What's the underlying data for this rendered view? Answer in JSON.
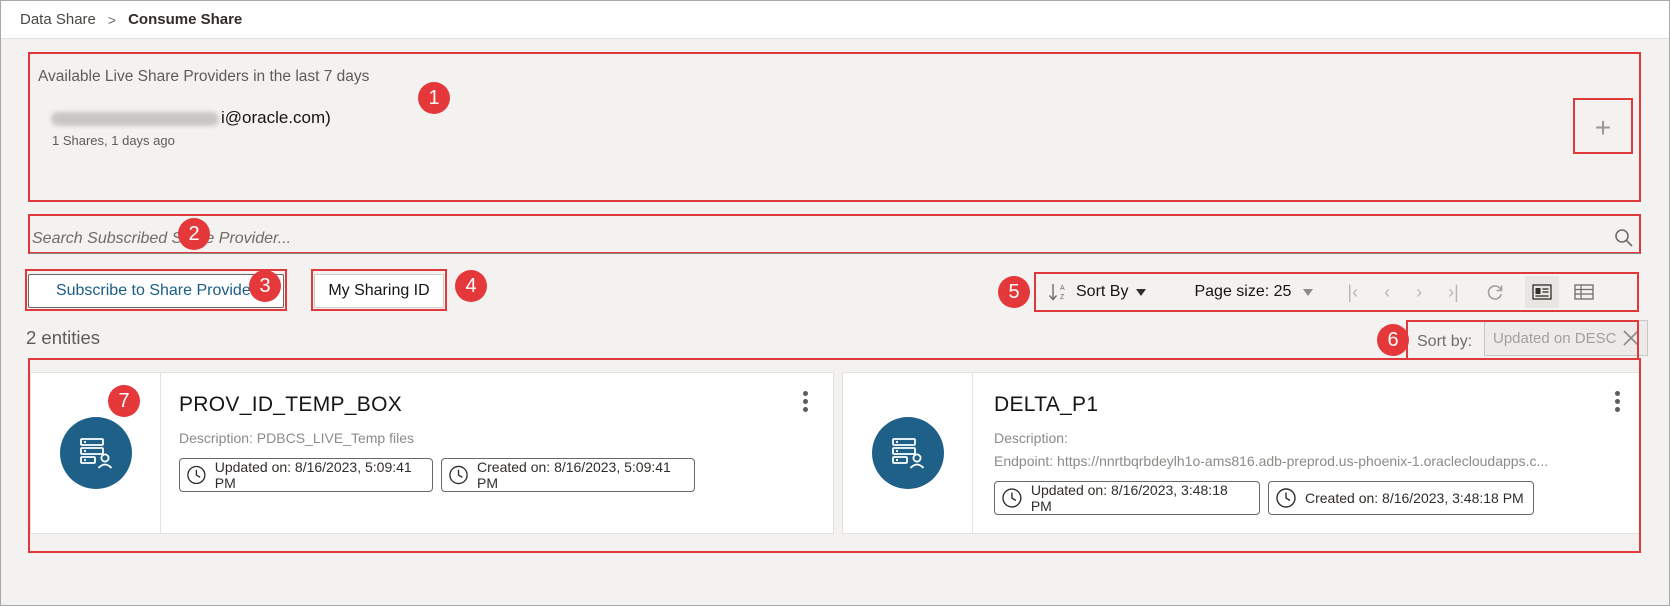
{
  "breadcrumb": {
    "parent": "Data Share",
    "separator": ">",
    "current": "Consume Share"
  },
  "providers": {
    "title": "Available Live Share Providers in the last 7 days",
    "email_visible": "i@oracle.com)",
    "meta": "1 Shares, 1 days ago",
    "add_label": "+"
  },
  "search": {
    "placeholder": "Search Subscribed Share Provider..."
  },
  "actions": {
    "subscribe_label": "Subscribe to Share Provider",
    "sharing_id_label": "My Sharing ID"
  },
  "toolbar": {
    "sort_label": "Sort By",
    "page_size_label": "Page size: 25"
  },
  "results": {
    "count_label": "2 entities",
    "sort_by_label": "Sort by:",
    "sort_chip": "Updated on DESC"
  },
  "cards": [
    {
      "title": "PROV_ID_TEMP_BOX",
      "description": "Description: PDBCS_LIVE_Temp files",
      "endpoint": "",
      "updated": "Updated on: 8/16/2023, 5:09:41 PM",
      "created": "Created on: 8/16/2023, 5:09:41 PM"
    },
    {
      "title": "DELTA_P1",
      "description": "Description:",
      "endpoint": "Endpoint: https://nnrtbqrbdeylh1o-ams816.adb-preprod.us-phoenix-1.oraclecloudapps.c...",
      "updated": "Updated on: 8/16/2023, 3:48:18 PM",
      "created": "Created on: 8/16/2023, 3:48:18 PM"
    }
  ],
  "annotations": [
    "1",
    "2",
    "3",
    "4",
    "5",
    "6",
    "7"
  ],
  "colors": {
    "annotation": "#e0393b",
    "avatar": "#1f6088",
    "link": "#1a5e86"
  }
}
